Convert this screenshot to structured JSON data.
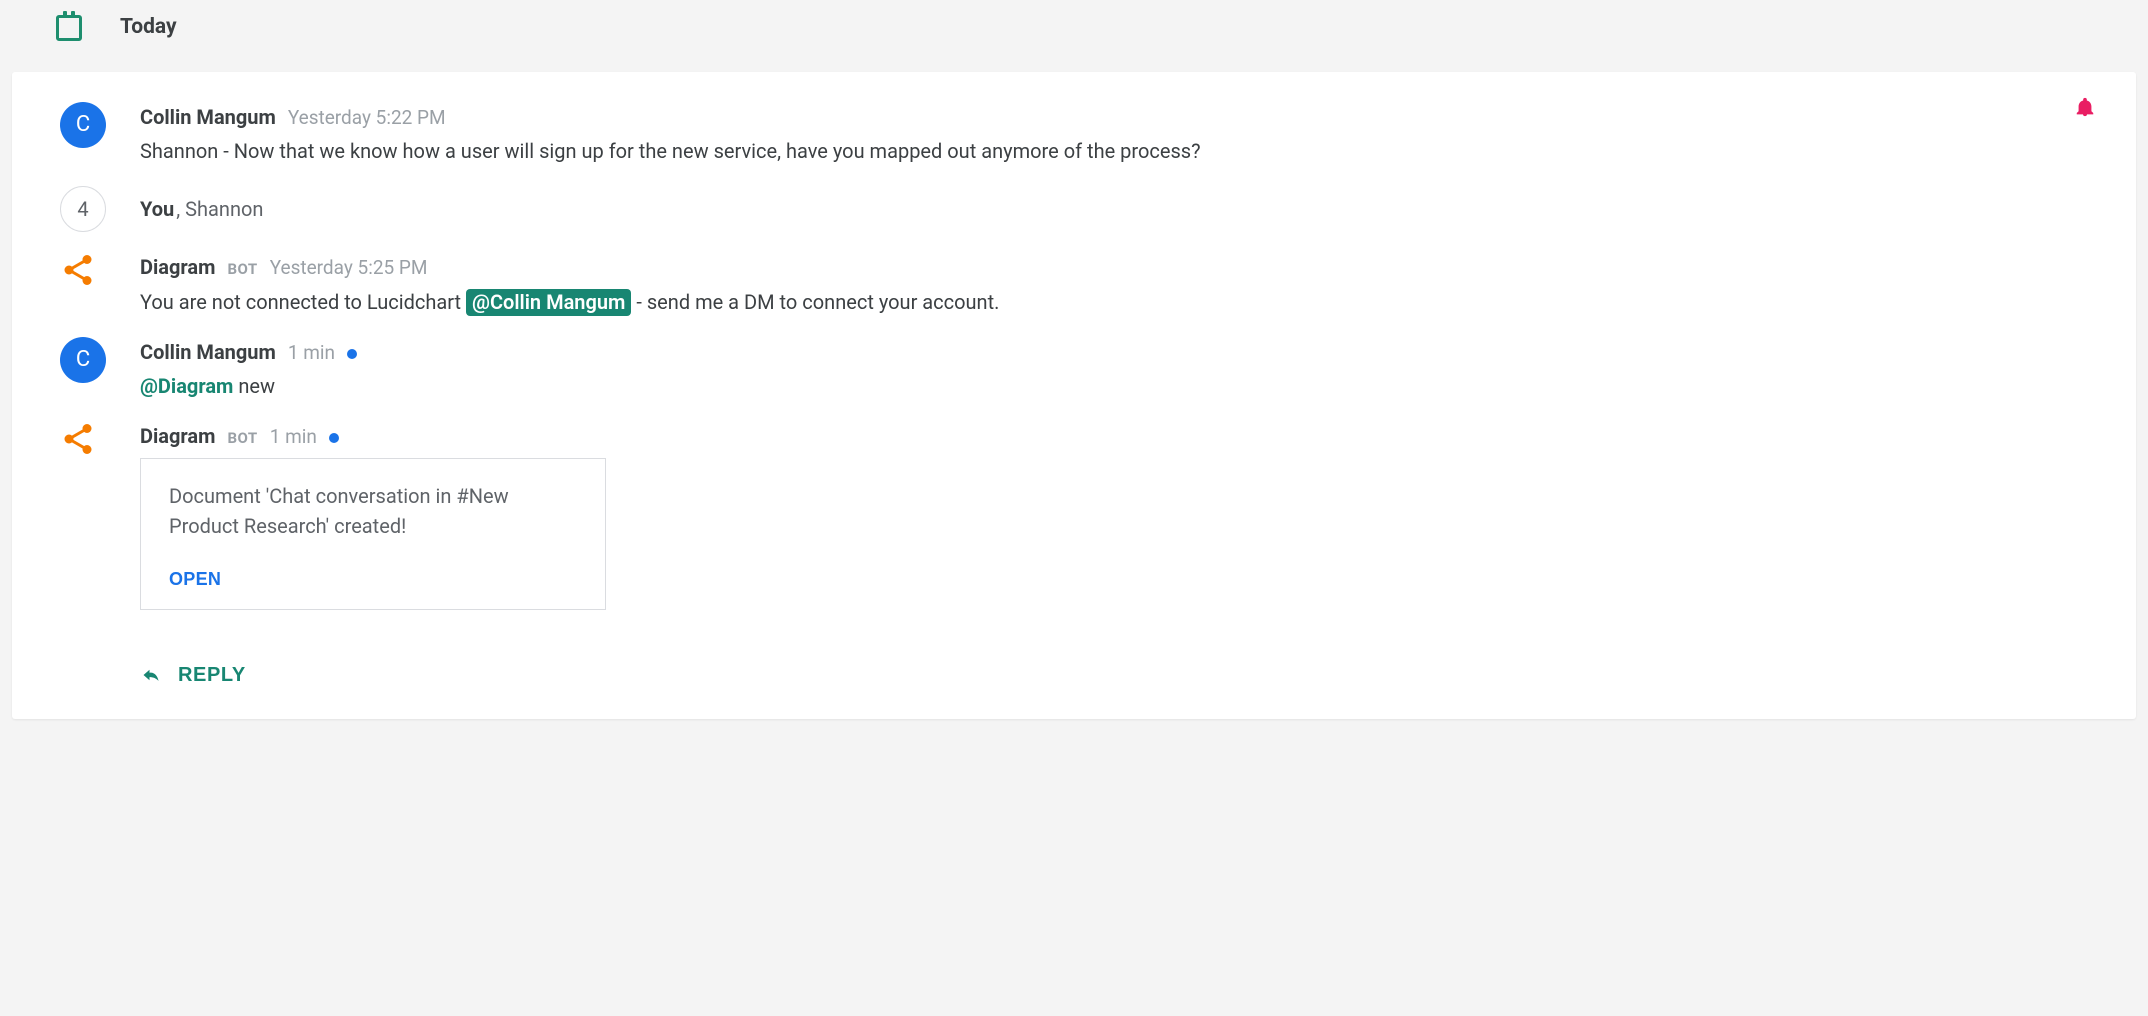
{
  "colors": {
    "accent_green": "#188672",
    "accent_blue": "#1a73e8",
    "bot_orange": "#f57c00",
    "alert_pink": "#e91e63"
  },
  "header": {
    "date_label": "Today"
  },
  "notification_icon": "bell-icon",
  "messages": [
    {
      "kind": "msg",
      "author": "Collin Mangum",
      "avatar": {
        "type": "initial",
        "letter": "C"
      },
      "timestamp": "Yesterday 5:22 PM",
      "text": "Shannon - Now that we know how a user will sign up for the new service, have you mapped out anymore of the process?"
    },
    {
      "kind": "read",
      "avatar_count": "4",
      "you": "You",
      "others": ", Shannon"
    },
    {
      "kind": "msg",
      "author": "Diagram",
      "is_bot": true,
      "bot_label": "BOT",
      "avatar": {
        "type": "share"
      },
      "timestamp": "Yesterday 5:25 PM",
      "text_pre": "You are not connected to Lucidchart ",
      "mention_pill": "@Collin Mangum",
      "text_post": " - send me a DM to connect your account."
    },
    {
      "kind": "msg",
      "author": "Collin Mangum",
      "avatar": {
        "type": "initial",
        "letter": "C"
      },
      "timestamp": "1 min",
      "new_dot": true,
      "mention_link": "@Diagram",
      "text_post": " new"
    },
    {
      "kind": "msg",
      "author": "Diagram",
      "is_bot": true,
      "bot_label": "BOT",
      "avatar": {
        "type": "share"
      },
      "timestamp": "1 min",
      "new_dot": true,
      "card": {
        "text": "Document 'Chat conversation in #New Product Research' created!",
        "open_label": "OPEN"
      }
    }
  ],
  "reply": {
    "label": "REPLY"
  }
}
